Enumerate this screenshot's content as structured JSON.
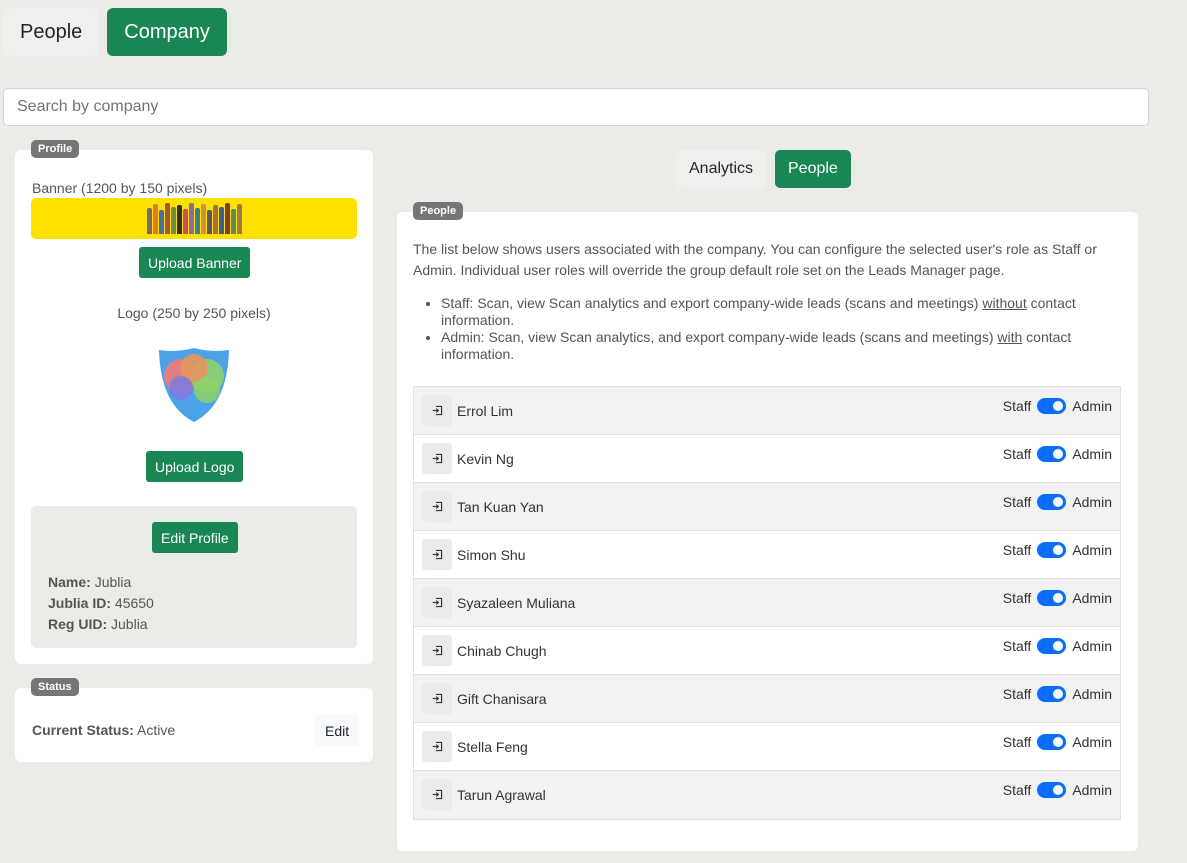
{
  "top_tabs": [
    {
      "label": "People",
      "active": false
    },
    {
      "label": "Company",
      "active": true
    }
  ],
  "search": {
    "placeholder": "Search by company",
    "value": ""
  },
  "profile": {
    "badge": "Profile",
    "banner_label": "Banner (1200 by 150 pixels)",
    "upload_banner_label": "Upload Banner",
    "logo_label": "Logo (250 by 250 pixels)",
    "upload_logo_label": "Upload Logo",
    "edit_profile_label": "Edit Profile",
    "name_label": "Name:",
    "name_value": "Jublia",
    "id_label": "Jublia ID:",
    "id_value": "45650",
    "uid_label": "Reg UID:",
    "uid_value": "Jublia"
  },
  "status": {
    "badge": "Status",
    "label": "Current Status:",
    "value": "Active",
    "edit_label": "Edit"
  },
  "sub_tabs": [
    {
      "label": "Analytics",
      "active": false
    },
    {
      "label": "People",
      "active": true
    }
  ],
  "people": {
    "badge": "People",
    "description": "The list below shows users associated with the company. You can configure the selected user's role as Staff or Admin. Individual user roles will override the group default role set on the Leads Manager page.",
    "staff_text_1": "Staff: Scan, view Scan analytics and export company-wide leads (scans and meetings) ",
    "staff_emph": "without",
    "staff_text_2": " contact information.",
    "admin_text_1": "Admin: Scan, view Scan analytics, and export company-wide leads (scans and meetings) ",
    "admin_emph": "with",
    "admin_text_2": " contact information.",
    "role_left": "Staff",
    "role_right": "Admin",
    "users": [
      {
        "name": "Errol Lim",
        "role": "Admin"
      },
      {
        "name": "Kevin Ng",
        "role": "Admin"
      },
      {
        "name": "Tan Kuan Yan",
        "role": "Admin"
      },
      {
        "name": "Simon Shu",
        "role": "Admin"
      },
      {
        "name": "Syazaleen Muliana",
        "role": "Admin"
      },
      {
        "name": "Chinab Chugh",
        "role": "Admin"
      },
      {
        "name": "Gift Chanisara",
        "role": "Admin"
      },
      {
        "name": "Stella Feng",
        "role": "Admin"
      },
      {
        "name": "Tarun Agrawal",
        "role": "Admin"
      }
    ]
  },
  "colors": {
    "accent": "#198754",
    "toggle": "#0d6efd",
    "banner": "#ffe100",
    "badge": "#757575",
    "background": "#edebe7"
  },
  "icons": {
    "login": "login-icon",
    "logo": "shield-logo"
  }
}
